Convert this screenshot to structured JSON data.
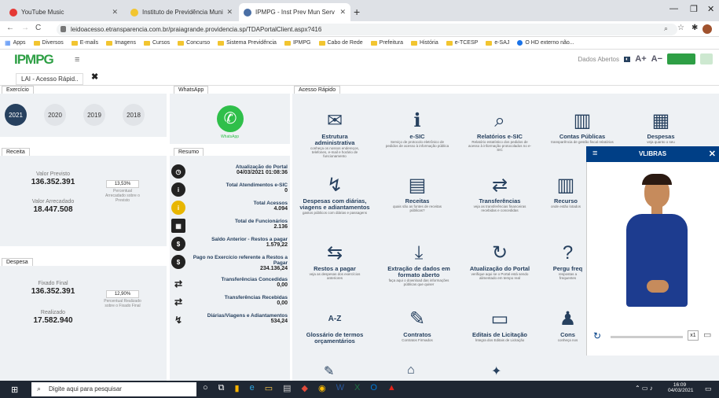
{
  "browser": {
    "tabs": [
      {
        "title": "YouTube Music",
        "favicon_color": "#e53935"
      },
      {
        "title": "Instituto de Previdência Municip",
        "favicon_color": "#f2c530"
      },
      {
        "title": "IPMPG - Inst Prev Mun Serv Públ",
        "favicon_color": "#4a6fa5"
      }
    ],
    "url": "leidoacesso.etransparencia.com.br/praiagrande.providencia.sp/TDAPortalClient.aspx?416",
    "bookmarks": [
      "Apps",
      "Diversos",
      "E-mails",
      "Imagens",
      "Cursos",
      "Concurso",
      "Sistema Previdência",
      "IPMPG",
      "Cabo de Rede",
      "Prefeitura",
      "História",
      "e-TCESP",
      "e-SAJ",
      "O HD externo não..."
    ]
  },
  "app": {
    "logo": "IPMPG",
    "header_link": "Dados Abertos",
    "font_plus": "A+",
    "font_minus": "A−",
    "page_tab": "LAI - Acesso Rápid..",
    "brand_color": "#27415f"
  },
  "exercicio": {
    "title": "Exercício",
    "years": [
      "2021",
      "2020",
      "2019",
      "2018"
    ]
  },
  "receita": {
    "title": "Receita",
    "previsto_label": "Valor Previsto",
    "previsto": "136.352.391",
    "pct": "13,53%",
    "pct_caption": "Percentual Arrecadado sobre o Previsto",
    "arrecadado_label": "Valor Arrecadado",
    "arrecadado": "18.447.508"
  },
  "despesa": {
    "title": "Despesa",
    "fixado_label": "Fixado Final",
    "fixado": "136.352.391",
    "pct": "12,90%",
    "pct_caption": "Percentual Realizado sobre o Fixado Final",
    "realizado_label": "Realizado",
    "realizado": "17.582.940"
  },
  "whatsapp": {
    "title": "WhatsApp",
    "label": "WhatsApp"
  },
  "resumo": {
    "title": "Resumo",
    "rows": [
      {
        "title": "Atualização do Portal",
        "value": "04/03/2021 01:08:36",
        "icon": "clock-icon"
      },
      {
        "title": "Total Atendimentos e-SIC",
        "value": "0",
        "icon": "info-icon"
      },
      {
        "title": "Total Acessos",
        "value": "4.094",
        "icon": "info-icon"
      },
      {
        "title": "Total de Funcionários",
        "value": "2.136",
        "icon": "building-icon"
      },
      {
        "title": "Saldo Anterior - Restos a pagar",
        "value": "1.579,22",
        "icon": "money-icon"
      },
      {
        "title": "Pago no Exercício referente a Restos a Pagar",
        "value": "234.136,24",
        "icon": "money-icon"
      },
      {
        "title": "Transferências Concedidas",
        "value": "0,00",
        "icon": "transfer-icon"
      },
      {
        "title": "Transferências Recebidas",
        "value": "0,00",
        "icon": "transfer-icon"
      },
      {
        "title": "Diárias/Viagens e Adiantamentos",
        "value": "534,24",
        "icon": "route-icon"
      }
    ]
  },
  "acesso": {
    "title": "Acesso Rápido",
    "tiles": [
      {
        "title": "Estrutura administrativa",
        "sub": "conheça os nossos endereços, telefones, e-mail e horário de funcionamento",
        "icon": "✉"
      },
      {
        "title": "e-SIC",
        "sub": "Serviço de protocolo eletrônico de pedidos de acesso à informação pública",
        "icon": "ℹ"
      },
      {
        "title": "Relatórios e-SIC",
        "sub": "Relatório estatístico dos pedidos de acesso à informação protocolados no e-SIC",
        "icon": "⌕"
      },
      {
        "title": "Contas Públicas",
        "sub": "transparência de gestão fiscal relatórios",
        "icon": "▥"
      },
      {
        "title": "Despesas",
        "sub": "veja quanto o seu",
        "icon": "▦"
      },
      {
        "title": "Despesas com diárias, viagens e adiantamentos",
        "sub": "gastos públicos com diárias e passagens",
        "icon": "↯"
      },
      {
        "title": "Receitas",
        "sub": "quais são as fontes de receitas públicas?",
        "icon": "▤"
      },
      {
        "title": "Transferências",
        "sub": "veja as transferências financeiras recebidas e concedidas",
        "icon": "⇄"
      },
      {
        "title": "Recurso",
        "sub": "onde estão lotados",
        "icon": "▥"
      },
      {
        "title": "Restos a pagar",
        "sub": "veja as despesas dos exercícios anteriores",
        "icon": "⇆"
      },
      {
        "title": "Extração de dados em formato aberto",
        "sub": "faça aqui o download das informações públicas que quiser",
        "icon": "⤓"
      },
      {
        "title": "Atualização do Portal",
        "sub": "verifique aqui se o Portal está sendo alimentado em tempo real",
        "icon": "↻"
      },
      {
        "title": "Pergu freq",
        "sub": "respostas a frequentes",
        "icon": "?"
      },
      {
        "title": "Glossário de termos orçamentários",
        "sub": "",
        "icon": "A-Z"
      },
      {
        "title": "Contratos",
        "sub": "Contratos Firmados",
        "icon": "✎"
      },
      {
        "title": "Editais de Licitação",
        "sub": "Íntegra dos Editais de Licitação",
        "icon": "▭"
      },
      {
        "title": "Cons",
        "sub": "conheça nos",
        "icon": "♟"
      }
    ]
  },
  "vlibras": {
    "title": "VLIBRAS",
    "speed": "x1"
  },
  "taskbar": {
    "search_placeholder": "Digite aqui para pesquisar",
    "time": "16:09",
    "date": "04/03/2021"
  }
}
